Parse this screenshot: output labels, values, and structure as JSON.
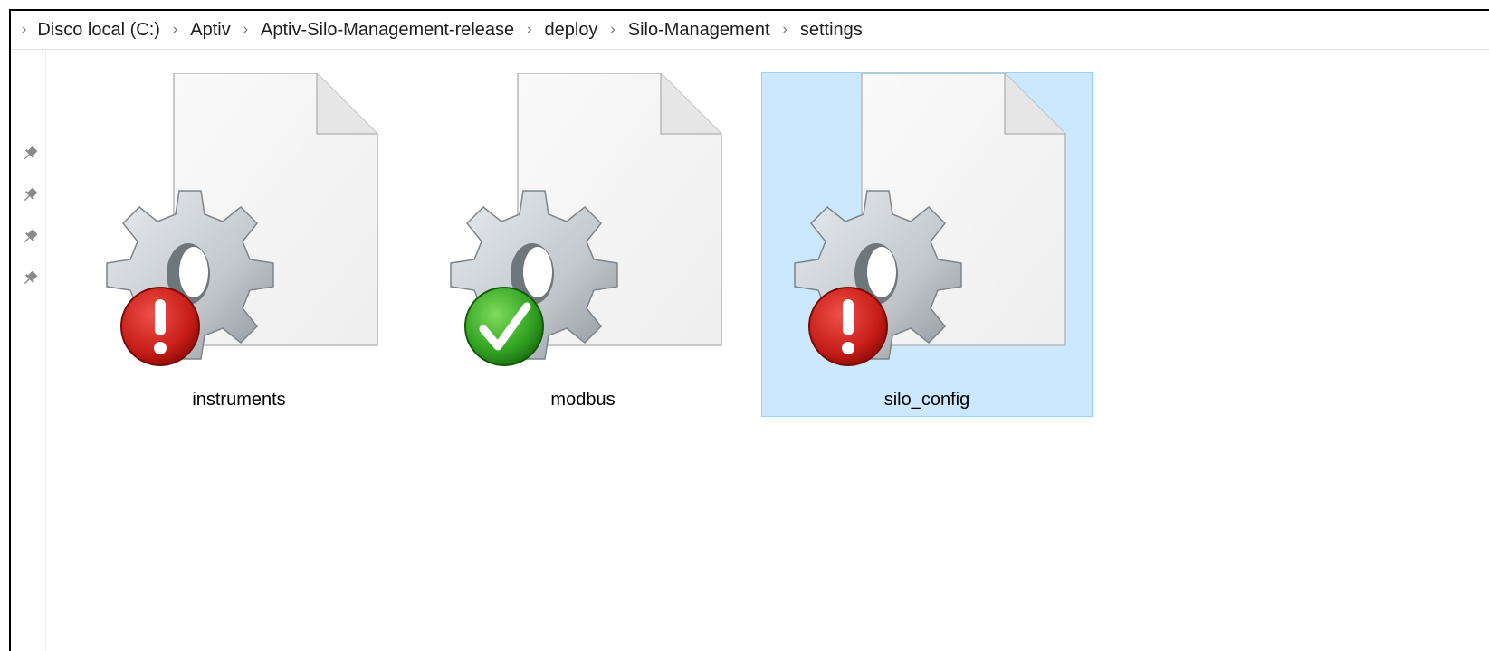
{
  "breadcrumb": {
    "items": [
      "Disco local (C:)",
      "Aptiv",
      "Aptiv-Silo-Management-release",
      "deploy",
      "Silo-Management",
      "settings"
    ]
  },
  "quick_access": {
    "pins": [
      "pin-icon",
      "pin-icon",
      "pin-icon",
      "pin-icon"
    ]
  },
  "files": [
    {
      "name": "instruments",
      "status": "error",
      "selected": false
    },
    {
      "name": "modbus",
      "status": "ok",
      "selected": false
    },
    {
      "name": "silo_config",
      "status": "error",
      "selected": true
    }
  ],
  "colors": {
    "selection_bg": "#cce8ff",
    "selection_border": "#99d1ff",
    "error": "#c8201b",
    "ok": "#2c9a1c"
  }
}
